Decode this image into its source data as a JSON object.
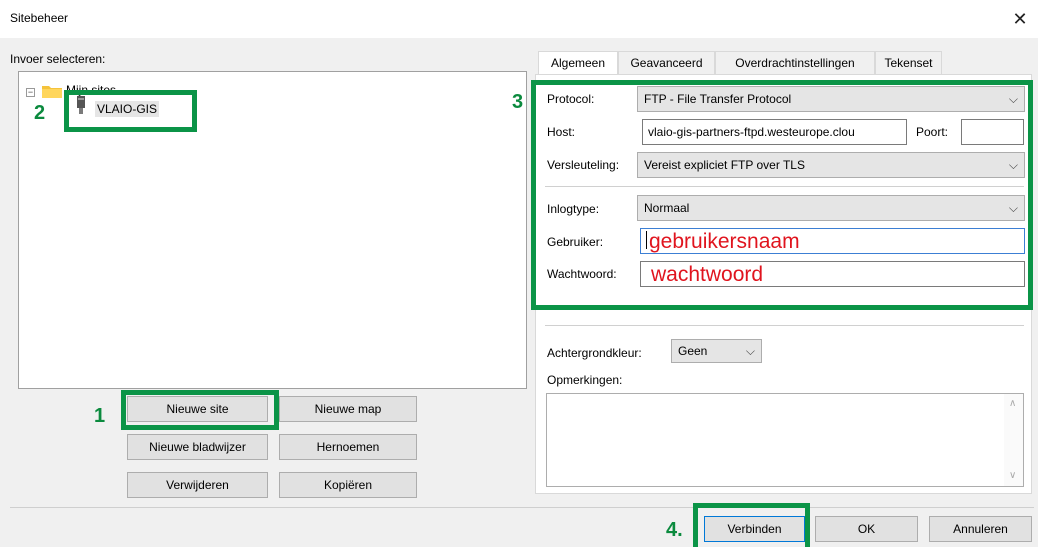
{
  "window": {
    "title": "Sitebeheer",
    "close_glyph": "✕"
  },
  "left": {
    "select_label": "Invoer selecteren:",
    "tree": {
      "root": "Mijn sites",
      "site": "VLAIO-GIS"
    },
    "buttons": {
      "new_site": "Nieuwe site",
      "new_folder": "Nieuwe map",
      "new_bookmark": "Nieuwe bladwijzer",
      "rename": "Hernoemen",
      "delete": "Verwijderen",
      "copy": "Kopiëren"
    }
  },
  "tabs": [
    "Algemeen",
    "Geavanceerd",
    "Overdrachtinstellingen",
    "Tekenset"
  ],
  "general": {
    "protocol_label": "Protocol:",
    "protocol_value": "FTP - File Transfer Protocol",
    "host_label": "Host:",
    "host_value": "vlaio-gis-partners-ftpd.westeurope.clou",
    "port_label": "Poort:",
    "port_value": "",
    "encryption_label": "Versleuteling:",
    "encryption_value": "Vereist expliciet FTP over TLS",
    "logontype_label": "Inlogtype:",
    "logontype_value": "Normaal",
    "user_label": "Gebruiker:",
    "user_value": "gebruikersnaam",
    "password_label": "Wachtwoord:",
    "password_value": "wachtwoord",
    "bgcolor_label": "Achtergrondkleur:",
    "bgcolor_value": "Geen",
    "comments_label": "Opmerkingen:"
  },
  "footer": {
    "connect": "Verbinden",
    "ok": "OK",
    "cancel": "Annuleren"
  },
  "annotations": {
    "n1": "1",
    "n2": "2",
    "n3": "3",
    "n4": "4."
  },
  "colors": {
    "highlight": "#0b9447",
    "annotation_text": "#e0141e"
  }
}
